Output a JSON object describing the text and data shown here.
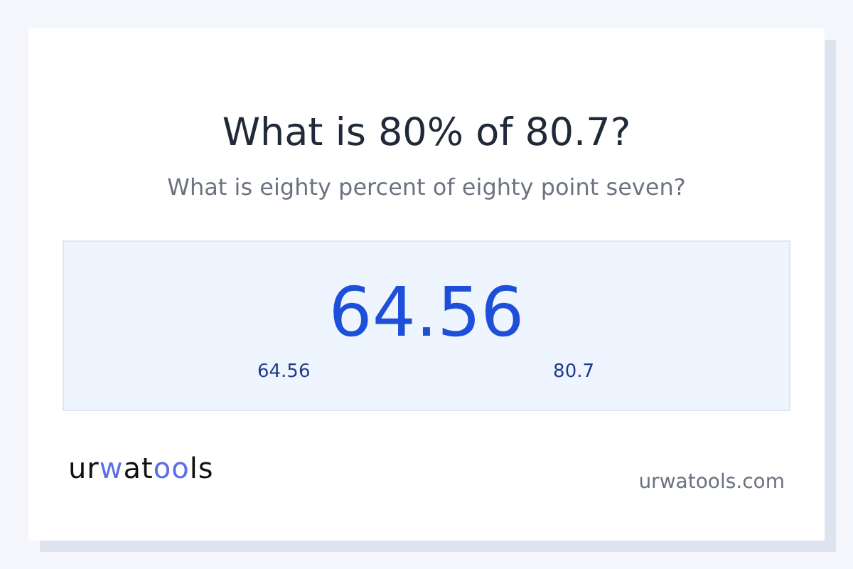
{
  "title": "What is 80% of 80.7?",
  "subtitle": "What is eighty percent of eighty point seven?",
  "result": {
    "value": "64.56",
    "left_label": "64.56",
    "right_label": "80.7"
  },
  "logo": [
    {
      "text": "ur",
      "accent": false
    },
    {
      "text": "w",
      "accent": true
    },
    {
      "text": "at",
      "accent": false
    },
    {
      "text": "oo",
      "accent": true
    },
    {
      "text": "ls",
      "accent": false
    }
  ],
  "site": "urwatools.com"
}
